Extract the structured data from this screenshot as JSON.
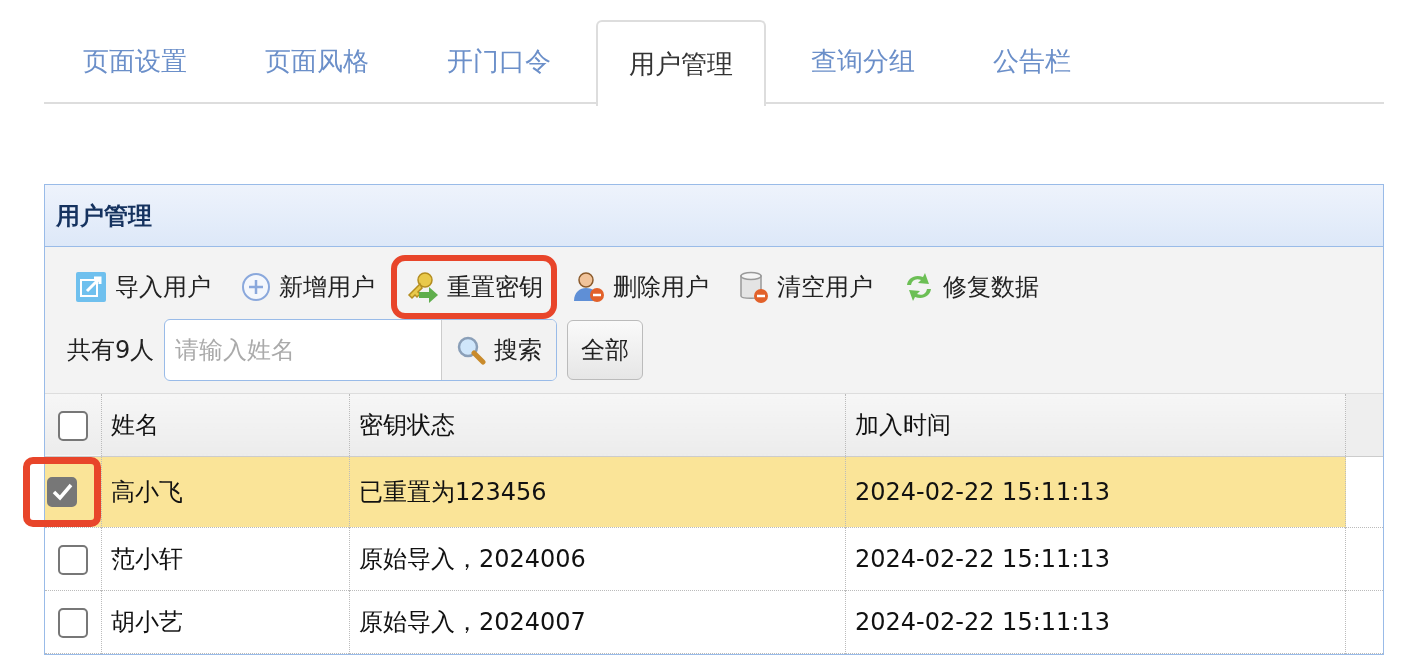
{
  "tabs": [
    {
      "label": "页面设置",
      "selected": false
    },
    {
      "label": "页面风格",
      "selected": false
    },
    {
      "label": "开门口令",
      "selected": false
    },
    {
      "label": "用户管理",
      "selected": true
    },
    {
      "label": "查询分组",
      "selected": false
    },
    {
      "label": "公告栏",
      "selected": false
    }
  ],
  "panel": {
    "title": "用户管理",
    "toolbar": [
      {
        "label": "导入用户",
        "kind": "import",
        "highlighted": false
      },
      {
        "label": "新增用户",
        "kind": "add",
        "highlighted": false
      },
      {
        "label": "重置密钥",
        "kind": "key",
        "highlighted": true
      },
      {
        "label": "删除用户",
        "kind": "user-remove",
        "highlighted": false
      },
      {
        "label": "清空用户",
        "kind": "db-remove",
        "highlighted": false
      },
      {
        "label": "修复数据",
        "kind": "refresh",
        "highlighted": false
      }
    ],
    "count": "共有9人",
    "search": {
      "placeholder": "请输入姓名",
      "button": "搜索"
    },
    "all_button": "全部",
    "table": {
      "header_checked": false,
      "columns": [
        "姓名",
        "密钥状态",
        "加入时间"
      ],
      "rows": [
        {
          "checked": true,
          "highlighted": true,
          "cells": [
            "高小飞",
            "已重置为123456",
            "2024-02-22 15:11:13"
          ]
        },
        {
          "checked": false,
          "highlighted": false,
          "cells": [
            "范小轩",
            "原始导入，2024006",
            "2024-02-22 15:11:13"
          ]
        },
        {
          "checked": false,
          "highlighted": false,
          "cells": [
            "胡小艺",
            "原始导入，2024007",
            "2024-02-22 15:11:13"
          ]
        }
      ]
    }
  }
}
